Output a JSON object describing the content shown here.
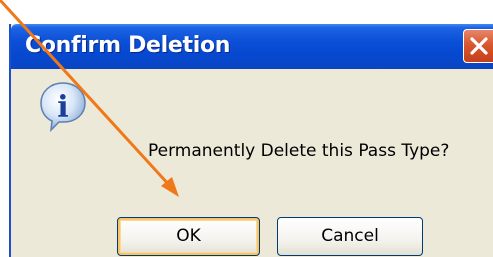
{
  "dialog": {
    "title": "Confirm Deletion",
    "message": "Permanently Delete this Pass Type?",
    "icon": "info-icon",
    "close_icon": "close-icon"
  },
  "buttons": {
    "ok_label": "OK",
    "cancel_label": "Cancel"
  },
  "annotation": {
    "arrow_color": "#f07818",
    "target": "ok-button"
  },
  "colors": {
    "titlebar": "#0a4fd6",
    "dialog_bg": "#ece9d8",
    "close_button": "#d9572f",
    "default_button_focus": "#f8c466"
  }
}
